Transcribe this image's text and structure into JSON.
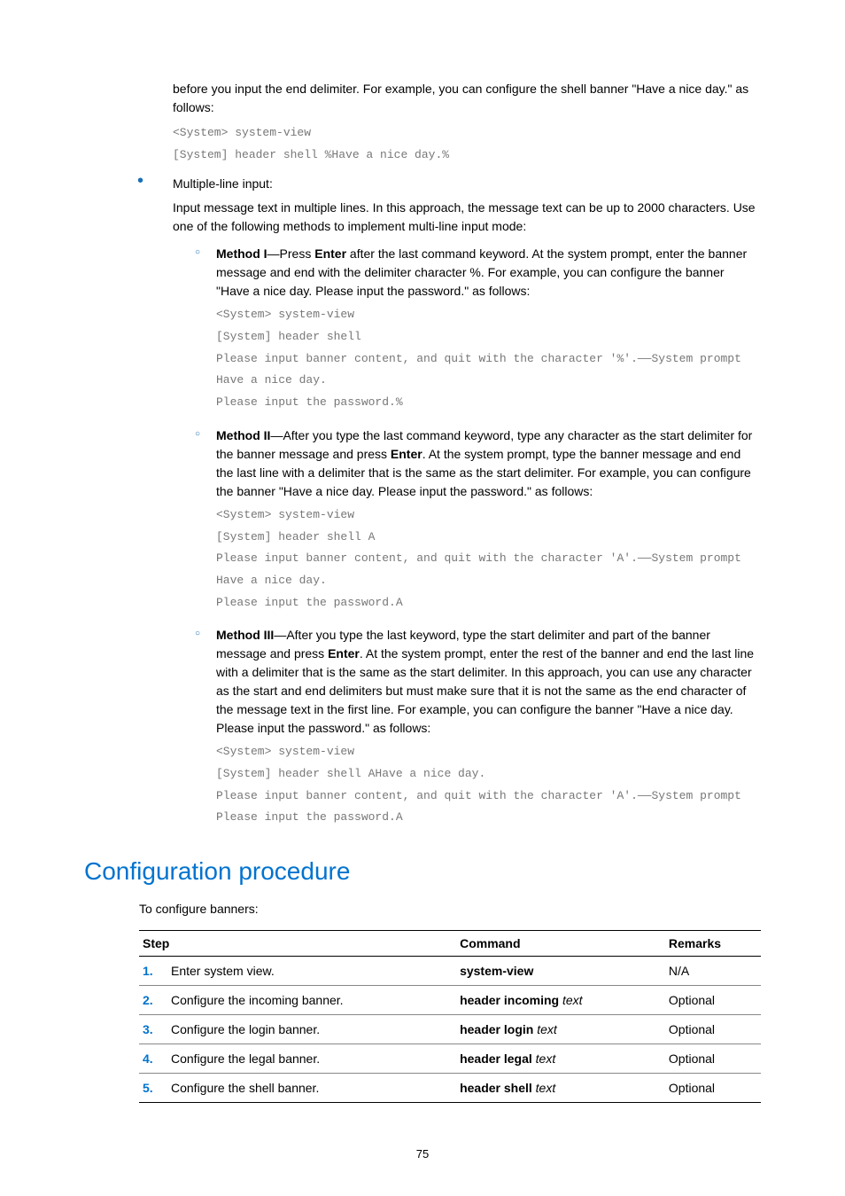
{
  "intro_para": "before you input the end delimiter. For example, you can configure the shell banner \"Have a nice day.\" as follows:",
  "code1": "<System> system-view\n[System] header shell %Have a nice day.%",
  "bullet_label": "Multiple-line input:",
  "bullet_para": "Input message text in multiple lines. In this approach, the message text can be up to 2000 characters. Use one of the following methods to implement multi-line input mode:",
  "m1_label": "Method I",
  "m1_text1": "—Press ",
  "m1_enter": "Enter",
  "m1_text2": " after the last command keyword. At the system prompt, enter the banner message and end with the delimiter character %. For example, you can configure the banner \"Have a nice day. Please input the password.\" as follows:",
  "m1_code": "<System> system-view\n[System] header shell\nPlease input banner content, and quit with the character '%'.——System prompt\nHave a nice day.\nPlease input the password.%",
  "m2_label": "Method II",
  "m2_text1": "—After you type the last command keyword, type any character as the start delimiter for the banner message and press ",
  "m2_enter": "Enter",
  "m2_text2": ". At the system prompt, type the banner message and end the last line with a delimiter that is the same as the start delimiter. For example, you can configure the banner \"Have a nice day. Please input the password.\" as follows:",
  "m2_code": "<System> system-view\n[System] header shell A\nPlease input banner content, and quit with the character 'A'.——System prompt\nHave a nice day.\nPlease input the password.A",
  "m3_label": "Method III",
  "m3_text1": "—After you type the last keyword, type the start delimiter and part of the banner message and press ",
  "m3_enter": "Enter",
  "m3_text2": ". At the system prompt, enter the rest of the banner and end the last line with a delimiter that is the same as the start delimiter. In this approach, you can use any character as the start and end delimiters but must make sure that it is not the same as the end character of the message text in the first line. For example, you can configure the banner \"Have a nice day. Please input the password.\" as follows:",
  "m3_code": "<System> system-view\n[System] header shell AHave a nice day.\nPlease input banner content, and quit with the character 'A'.——System prompt\nPlease input the password.A",
  "heading": "Configuration procedure",
  "table_intro": "To configure banners:",
  "table": {
    "headers": {
      "step": "Step",
      "command": "Command",
      "remarks": "Remarks"
    },
    "rows": [
      {
        "num": "1.",
        "step": "Enter system view.",
        "cmd_bold": "system-view",
        "cmd_ital": "",
        "remarks": "N/A"
      },
      {
        "num": "2.",
        "step": "Configure the incoming banner.",
        "cmd_bold": "header incoming",
        "cmd_ital": " text",
        "remarks": "Optional"
      },
      {
        "num": "3.",
        "step": "Configure the login banner.",
        "cmd_bold": "header login",
        "cmd_ital": " text",
        "remarks": "Optional"
      },
      {
        "num": "4.",
        "step": "Configure the legal banner.",
        "cmd_bold": "header legal",
        "cmd_ital": " text",
        "remarks": "Optional"
      },
      {
        "num": "5.",
        "step": "Configure the shell banner.",
        "cmd_bold": "header shell",
        "cmd_ital": " text",
        "remarks": "Optional"
      }
    ]
  },
  "page_number": "75"
}
